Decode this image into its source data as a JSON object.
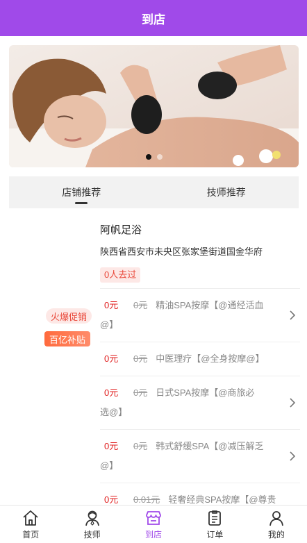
{
  "header": {
    "title": "到店"
  },
  "banner": {
    "alt_icon": "massage-photo",
    "slides": 2,
    "active_slide": 1
  },
  "tabs": [
    {
      "label": "店铺推荐",
      "active": true
    },
    {
      "label": "技师推荐",
      "active": false
    }
  ],
  "shop": {
    "name": "阿帆足浴",
    "address": "陕西省西安市未央区张家堡街道国金华府",
    "visited": "0人去过",
    "badges": {
      "hot": "火爆促销",
      "subsidy": "百亿补贴"
    },
    "services": [
      {
        "price": "0元",
        "orig": "0元",
        "name": "精油SPA按摩【@通经活血",
        "tail": "@】"
      },
      {
        "price": "0元",
        "orig": "0元",
        "name": "中医理疗【@全身按摩@】",
        "tail": ""
      },
      {
        "price": "0元",
        "orig": "0元",
        "name": "日式SPA按摩【@商旅必",
        "tail": "选@】"
      },
      {
        "price": "0元",
        "orig": "0元",
        "name": "韩式舒缓SPA【@减压解乏",
        "tail": "@】"
      },
      {
        "price": "0元",
        "orig": "0.01元",
        "name": "轻奢经典SPA按摩【@尊贵",
        "tail": ""
      }
    ]
  },
  "bottom_nav": [
    {
      "label": "首页",
      "icon": "home-icon",
      "active": false
    },
    {
      "label": "技师",
      "icon": "technician-icon",
      "active": false
    },
    {
      "label": "到店",
      "icon": "store-icon",
      "active": true
    },
    {
      "label": "订单",
      "icon": "order-icon",
      "active": false
    },
    {
      "label": "我的",
      "icon": "profile-icon",
      "active": false
    }
  ],
  "colors": {
    "brand": "#a04ae9",
    "price": "#e01e1e",
    "badge_bg": "#fde8e6"
  }
}
